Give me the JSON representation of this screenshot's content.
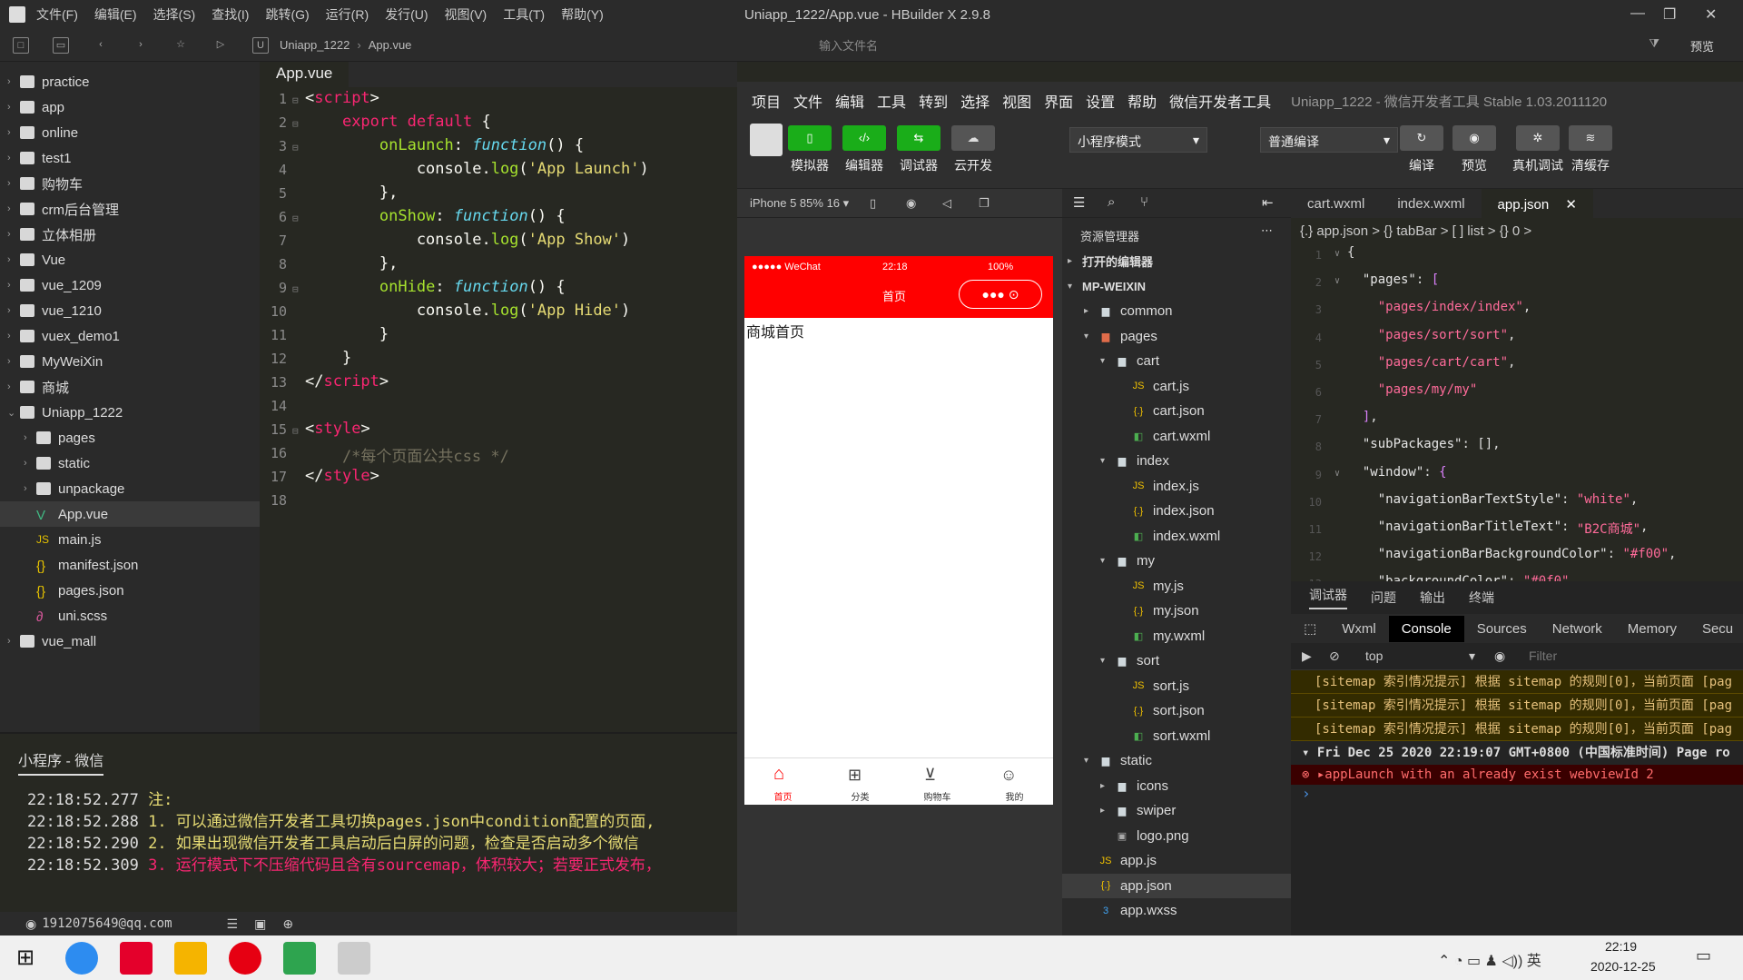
{
  "hbuilder": {
    "menu": [
      "文件(F)",
      "编辑(E)",
      "选择(S)",
      "查找(I)",
      "跳转(G)",
      "运行(R)",
      "发行(U)",
      "视图(V)",
      "工具(T)",
      "帮助(Y)"
    ],
    "window_title": "Uniapp_1222/App.vue - HBuilder X 2.9.8",
    "breadcrumb": [
      "Uniapp_1222",
      "App.vue"
    ],
    "search_placeholder": "输入文件名",
    "preview_label": "预览",
    "tree": [
      {
        "label": "practice",
        "kind": "folder"
      },
      {
        "label": "app",
        "kind": "folder"
      },
      {
        "label": "online",
        "kind": "folder"
      },
      {
        "label": "test1",
        "kind": "folder"
      },
      {
        "label": "购物车",
        "kind": "folder"
      },
      {
        "label": "crm后台管理",
        "kind": "folder"
      },
      {
        "label": "立体相册",
        "kind": "folder"
      },
      {
        "label": "Vue",
        "kind": "folder"
      },
      {
        "label": "vue_1209",
        "kind": "folder"
      },
      {
        "label": "vue_1210",
        "kind": "folder"
      },
      {
        "label": "vuex_demo1",
        "kind": "folder"
      },
      {
        "label": "MyWeiXin",
        "kind": "folder"
      },
      {
        "label": "商城",
        "kind": "folder"
      },
      {
        "label": "Uniapp_1222",
        "kind": "folder"
      },
      {
        "label": "pages",
        "kind": "folder"
      },
      {
        "label": "static",
        "kind": "folder"
      },
      {
        "label": "unpackage",
        "kind": "folder"
      },
      {
        "label": "App.vue",
        "kind": "vue"
      },
      {
        "label": "main.js",
        "kind": "js"
      },
      {
        "label": "manifest.json",
        "kind": "json"
      },
      {
        "label": "pages.json",
        "kind": "json"
      },
      {
        "label": "uni.scss",
        "kind": "scss"
      },
      {
        "label": "vue_mall",
        "kind": "folder"
      }
    ],
    "editor_tab": "App.vue",
    "console_title": "小程序 - 微信",
    "logs": [
      {
        "time": "22:18:52.277",
        "text": "注:"
      },
      {
        "time": "22:18:52.288",
        "text": "1. 可以通过微信开发者工具切换pages.json中condition配置的页面,"
      },
      {
        "time": "22:18:52.290",
        "text": "2. 如果出现微信开发者工具启动后白屏的问题，检查是否启动多个微信"
      },
      {
        "time": "22:18:52.309",
        "text": "3. 运行模式下不压缩代码且含有sourcemap，体积较大；若要正式发布，"
      }
    ],
    "status_user": "1912075649@qq.com"
  },
  "wechat": {
    "menu": [
      "项目",
      "文件",
      "编辑",
      "工具",
      "转到",
      "选择",
      "视图",
      "界面",
      "设置",
      "帮助",
      "微信开发者工具"
    ],
    "title": "Uniapp_1222 - 微信开发者工具 Stable 1.03.2011120",
    "tool_buttons": [
      "模拟器",
      "编辑器",
      "调试器",
      "云开发"
    ],
    "mode_select": "小程序模式",
    "compile_select": "普通编译",
    "right_buttons": [
      "编译",
      "预览",
      "真机调试",
      "清缓存"
    ],
    "device": "iPhone 5 85% 16",
    "phone": {
      "carrier": "●●●●● WeChat",
      "time": "22:18",
      "battery": "100%",
      "nav_title": "首页",
      "content": "商城首页",
      "tabs": [
        "首页",
        "分类",
        "购物车",
        "我的"
      ],
      "nav_color": "#ff0000"
    },
    "explorer_title": "资源管理器",
    "explorer": [
      {
        "label": "打开的编辑器",
        "lvl": 0,
        "bold": true
      },
      {
        "label": "MP-WEIXIN",
        "lvl": 0,
        "bold": true
      },
      {
        "label": "common",
        "lvl": 1
      },
      {
        "label": "pages",
        "lvl": 1
      },
      {
        "label": "cart",
        "lvl": 2
      },
      {
        "label": "cart.js",
        "lvl": 3
      },
      {
        "label": "cart.json",
        "lvl": 3
      },
      {
        "label": "cart.wxml",
        "lvl": 3
      },
      {
        "label": "index",
        "lvl": 2
      },
      {
        "label": "index.js",
        "lvl": 3
      },
      {
        "label": "index.json",
        "lvl": 3
      },
      {
        "label": "index.wxml",
        "lvl": 3
      },
      {
        "label": "my",
        "lvl": 2
      },
      {
        "label": "my.js",
        "lvl": 3
      },
      {
        "label": "my.json",
        "lvl": 3
      },
      {
        "label": "my.wxml",
        "lvl": 3
      },
      {
        "label": "sort",
        "lvl": 2
      },
      {
        "label": "sort.js",
        "lvl": 3
      },
      {
        "label": "sort.json",
        "lvl": 3
      },
      {
        "label": "sort.wxml",
        "lvl": 3
      },
      {
        "label": "static",
        "lvl": 1
      },
      {
        "label": "icons",
        "lvl": 2
      },
      {
        "label": "swiper",
        "lvl": 2
      },
      {
        "label": "logo.png",
        "lvl": 2
      },
      {
        "label": "app.js",
        "lvl": 1
      },
      {
        "label": "app.json",
        "lvl": 1
      },
      {
        "label": "app.wxss",
        "lvl": 1
      }
    ],
    "file_tabs": [
      "cart.wxml",
      "index.wxml",
      "app.json"
    ],
    "json_crumb": "{.} app.json  >  {} tabBar  >  [ ] list  >  {} 0  >",
    "debug_tabs": [
      "调试器",
      "问题",
      "输出",
      "终端"
    ],
    "console_tabs": [
      "Wxml",
      "Console",
      "Sources",
      "Network",
      "Memory",
      "Secu"
    ],
    "filter_context": "top",
    "filter_placeholder": "Filter",
    "warnings": [
      "[sitemap 索引情况提示] 根据 sitemap 的规则[0]，当前页面 [pag",
      "[sitemap 索引情况提示] 根据 sitemap 的规则[0]，当前页面 [pag",
      "[sitemap 索引情况提示] 根据 sitemap 的规则[0]，当前页面 [pag"
    ],
    "date_group": "Fri Dec 25 2020 22:19:07 GMT+0800 (中国标准时间) Page ro",
    "error": "▸appLaunch with an already exist webviewId 2"
  },
  "taskbar": {
    "time": "22:19",
    "date": "2020-12-25"
  }
}
